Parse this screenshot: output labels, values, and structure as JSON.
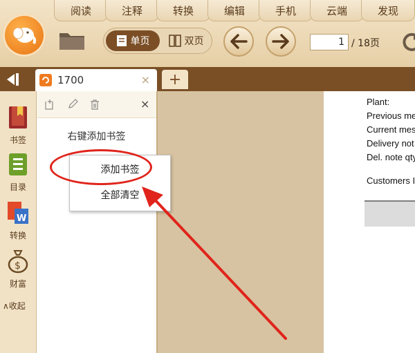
{
  "menu": {
    "items": [
      "阅读",
      "注释",
      "转换",
      "编辑",
      "手机",
      "云端",
      "发现"
    ]
  },
  "toolbar": {
    "single_page": "单页",
    "double_page": "双页",
    "page_current": "1",
    "page_total": "/ 18页"
  },
  "tabs": [
    {
      "label": "1700",
      "close": "×"
    }
  ],
  "new_tab": "+",
  "sidebar": {
    "items": [
      {
        "label": "书签",
        "icon": "bookmark-icon"
      },
      {
        "label": "目录",
        "icon": "toc-icon"
      },
      {
        "label": "转换",
        "icon": "convert-icon"
      },
      {
        "label": "财富",
        "icon": "money-bag-icon"
      }
    ],
    "collapse": "∧收起"
  },
  "bookmark_panel": {
    "close": "×",
    "hint": "右键添加书签"
  },
  "context_menu": {
    "add": "添加书签",
    "clear": "全部清空"
  },
  "document": {
    "lines": [
      "Plant:",
      "Previous me",
      "Current mes",
      "Delivery not",
      "Del. note qty",
      "Customers I"
    ]
  },
  "colors": {
    "accent": "#7a4f26",
    "highlight": "#e0241b",
    "logo": "#ef7a1f"
  }
}
